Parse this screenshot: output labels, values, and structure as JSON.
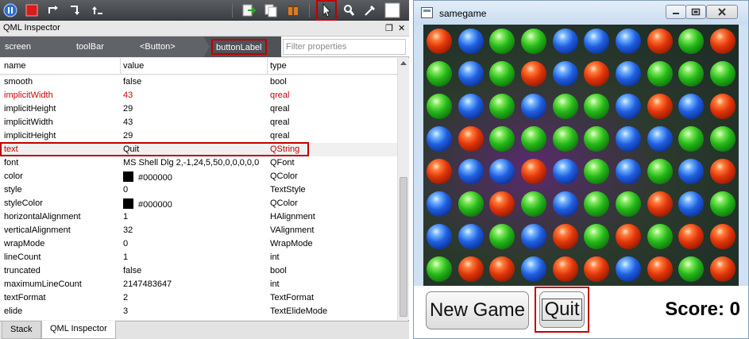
{
  "inspector": {
    "title": "QML Inspector",
    "title_icons": [
      "undock-icon",
      "close-icon"
    ],
    "breadcrumbs": [
      "screen",
      "toolBar",
      "<Button>",
      "buttonLabel"
    ],
    "filter_placeholder": "Filter properties",
    "columns": [
      "name",
      "value",
      "type"
    ],
    "rows": [
      {
        "name": "smooth",
        "value": "false",
        "type": "bool",
        "state": "normal"
      },
      {
        "name": "implicitWidth",
        "value": "43",
        "type": "qreal",
        "state": "changed"
      },
      {
        "name": "implicitHeight",
        "value": "29",
        "type": "qreal",
        "state": "normal"
      },
      {
        "name": "implicitWidth",
        "value": "43",
        "type": "qreal",
        "state": "normal"
      },
      {
        "name": "implicitHeight",
        "value": "29",
        "type": "qreal",
        "state": "normal"
      },
      {
        "name": "text",
        "value": "Quit",
        "type": "QString",
        "state": "selected"
      },
      {
        "name": "font",
        "value": "MS Shell Dlg 2,-1,24,5,50,0,0,0,0,0",
        "type": "QFont",
        "state": "normal"
      },
      {
        "name": "color",
        "value": "#000000",
        "type": "QColor",
        "state": "normal",
        "swatch": "#000000"
      },
      {
        "name": "style",
        "value": "0",
        "type": "TextStyle",
        "state": "normal"
      },
      {
        "name": "styleColor",
        "value": "#000000",
        "type": "QColor",
        "state": "normal",
        "swatch": "#000000"
      },
      {
        "name": "horizontalAlignment",
        "value": "1",
        "type": "HAlignment",
        "state": "normal"
      },
      {
        "name": "verticalAlignment",
        "value": "32",
        "type": "VAlignment",
        "state": "normal"
      },
      {
        "name": "wrapMode",
        "value": "0",
        "type": "WrapMode",
        "state": "normal"
      },
      {
        "name": "lineCount",
        "value": "1",
        "type": "int",
        "state": "normal"
      },
      {
        "name": "truncated",
        "value": "false",
        "type": "bool",
        "state": "normal"
      },
      {
        "name": "maximumLineCount",
        "value": "2147483647",
        "type": "int",
        "state": "normal"
      },
      {
        "name": "textFormat",
        "value": "2",
        "type": "TextFormat",
        "state": "normal"
      },
      {
        "name": "elide",
        "value": "3",
        "type": "TextElideMode",
        "state": "normal"
      }
    ],
    "tabs": [
      {
        "label": "Stack",
        "active": false
      },
      {
        "label": "QML Inspector",
        "active": true
      }
    ]
  },
  "toolbar": {
    "buttons": [
      "pause-icon",
      "stop-icon",
      "step-over-icon",
      "step-into-icon",
      "step-out-icon",
      "apply-changes-icon",
      "reload-icon",
      "animation-speed-icon",
      "select-tool-icon",
      "zoom-tool-icon",
      "color-picker-icon",
      "color-swatch-icon"
    ],
    "active_tool": "select-tool-icon"
  },
  "game": {
    "window_title": "samegame",
    "new_game_label": "New Game",
    "quit_label": "Quit",
    "score_label": "Score: 0",
    "grid": [
      [
        "red",
        "blue",
        "green",
        "green",
        "blue",
        "blue",
        "blue",
        "red",
        "green",
        "red"
      ],
      [
        "green",
        "blue",
        "green",
        "red",
        "blue",
        "red",
        "blue",
        "green",
        "green",
        "green"
      ],
      [
        "green",
        "blue",
        "green",
        "blue",
        "green",
        "green",
        "blue",
        "red",
        "blue",
        "red"
      ],
      [
        "blue",
        "red",
        "green",
        "green",
        "green",
        "green",
        "blue",
        "blue",
        "green",
        "green"
      ],
      [
        "red",
        "blue",
        "blue",
        "red",
        "blue",
        "green",
        "blue",
        "green",
        "blue",
        "red"
      ],
      [
        "blue",
        "green",
        "red",
        "green",
        "blue",
        "green",
        "green",
        "red",
        "blue",
        "green"
      ],
      [
        "blue",
        "blue",
        "green",
        "blue",
        "red",
        "green",
        "red",
        "green",
        "red",
        "red"
      ],
      [
        "green",
        "red",
        "red",
        "blue",
        "red",
        "red",
        "blue",
        "red",
        "green",
        "red"
      ]
    ]
  },
  "colors": {
    "toolbar_bg": "#4a4d52",
    "highlight": "#c00000",
    "changed_text": "#cc0000",
    "window_frame": "#cfe1f3"
  }
}
